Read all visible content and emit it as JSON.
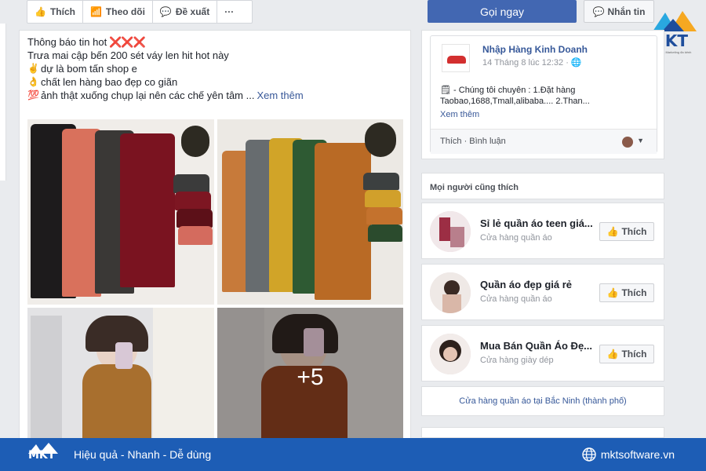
{
  "toolbar": {
    "like_label": "Thích",
    "follow_label": "Theo dõi",
    "recommend_label": "Đề xuất",
    "more_label": "···"
  },
  "actions": {
    "call_label": "Gọi ngay",
    "message_label": "Nhắn tin"
  },
  "brand": {
    "name": "MKT",
    "tagline": "Phần mềm Marketing đa kênh"
  },
  "post": {
    "lines": [
      {
        "text": "Thông báo tin hot",
        "suffix": "❌❌❌"
      },
      {
        "text": "Trưa mai cập bến 200 sét váy len hit hot này"
      },
      {
        "emoji": "✌",
        "text": "dự là bom tấn shop e"
      },
      {
        "emoji": "👌",
        "text": "chất len hàng bao đẹp co giãn"
      },
      {
        "emoji": "💯",
        "text": "ảnh thật xuống chụp lại nên các chế yên tâm ...",
        "link": "Xem thêm"
      }
    ],
    "more_photos": "+5"
  },
  "page_card": {
    "name": "Nhập Hàng Kinh Doanh",
    "time": "14 Tháng 8 lúc 12:32 · 🌐",
    "body": "Chúng tôi chuyên : 1.Đặt hàng Taobao,1688,Tmall,alibaba.... 2.Than...",
    "see_more": "Xem thêm",
    "actions": "Thích · Bình luận"
  },
  "likes": {
    "heading": "Mọi người cũng thích",
    "items": [
      {
        "title": "Sỉ lẻ quần áo teen giá...",
        "subtitle": "Cửa hàng quần áo",
        "button": "Thích"
      },
      {
        "title": "Quần áo đẹp giá rẻ",
        "subtitle": "Cửa hàng quần áo",
        "button": "Thích"
      },
      {
        "title": "Mua Bán Quần Áo Đẹ...",
        "subtitle": "Cửa hàng giày dép",
        "button": "Thích"
      }
    ],
    "location_link": "Cửa hàng quần áo tại Bắc Ninh (thành phố)"
  },
  "footer": {
    "logo": "MKT",
    "slogan": "Hiệu quả - Nhanh - Dễ dùng",
    "website": "mktsoftware.vn"
  },
  "colors": {
    "facebook_blue": "#4267b2",
    "footer_blue": "#1d5db5",
    "link_blue": "#385898"
  }
}
